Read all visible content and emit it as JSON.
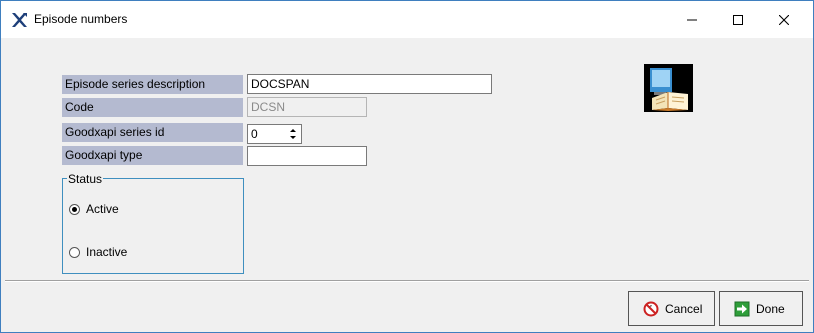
{
  "window": {
    "title": "Episode numbers"
  },
  "form": {
    "fields": [
      {
        "label": "Episode series description",
        "value": "DOCSPAN"
      },
      {
        "label": "Code",
        "value": "DCSN"
      },
      {
        "label": "Goodxapi series id",
        "value": "0"
      },
      {
        "label": "Goodxapi type",
        "value": ""
      }
    ],
    "status": {
      "legend": "Status",
      "options": [
        {
          "label": "Active",
          "selected": true
        },
        {
          "label": "Inactive",
          "selected": false
        }
      ]
    }
  },
  "buttons": {
    "cancel": "Cancel",
    "done": "Done"
  },
  "colors": {
    "label_bg": "#b4bad0",
    "accent": "#3f8fbf",
    "done_icon": "#2e9e3a",
    "cancel_icon": "#cc2222"
  }
}
